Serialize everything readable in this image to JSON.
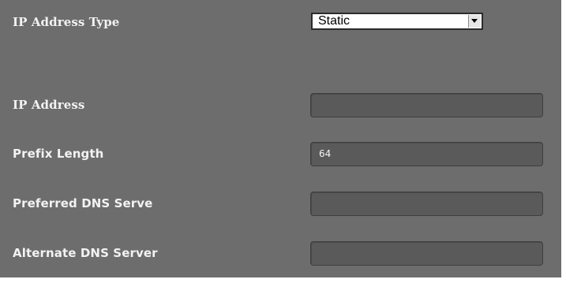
{
  "ip_address_type": {
    "label": "IP Address Type",
    "selected": "Static"
  },
  "ip_address": {
    "label": "IP Address",
    "value": ""
  },
  "prefix_length": {
    "label": "Prefix Length",
    "value": "64"
  },
  "preferred_dns": {
    "label": "Preferred DNS Serve",
    "value": ""
  },
  "alternate_dns": {
    "label": "Alternate DNS Server",
    "value": ""
  }
}
